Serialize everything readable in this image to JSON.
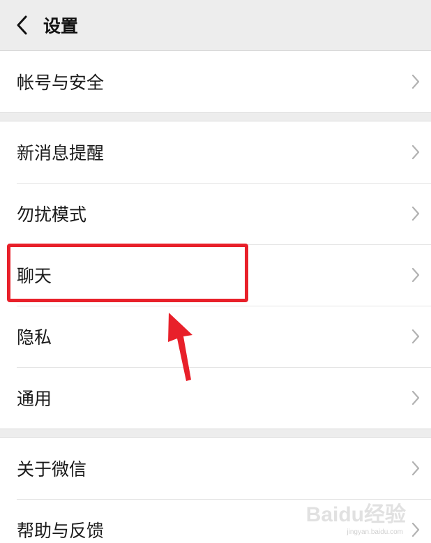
{
  "header": {
    "title": "设置",
    "back_icon": "chevron-left-icon"
  },
  "groups": [
    {
      "items": [
        {
          "label": "帐号与安全"
        }
      ]
    },
    {
      "items": [
        {
          "label": "新消息提醒"
        },
        {
          "label": "勿扰模式"
        },
        {
          "label": "聊天"
        },
        {
          "label": "隐私"
        },
        {
          "label": "通用"
        }
      ]
    },
    {
      "items": [
        {
          "label": "关于微信"
        },
        {
          "label": "帮助与反馈"
        }
      ]
    }
  ],
  "annotation": {
    "color": "#e8202a",
    "highlighted_item": "聊天"
  },
  "watermark": {
    "text": "Baidu经验",
    "sub": "jingyan.baidu.com"
  }
}
